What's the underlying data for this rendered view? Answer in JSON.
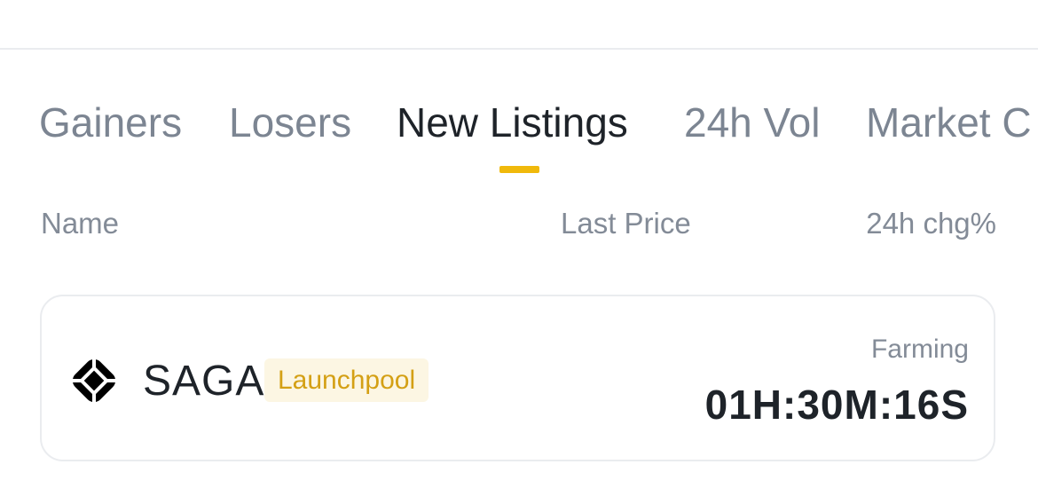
{
  "tabs": [
    {
      "label": "Gainers",
      "active": false
    },
    {
      "label": "Losers",
      "active": false
    },
    {
      "label": "New Listings",
      "active": true
    },
    {
      "label": "24h Vol",
      "active": false
    },
    {
      "label": "Market C",
      "active": false
    }
  ],
  "columns": {
    "name": "Name",
    "last_price": "Last Price",
    "change": "24h chg%"
  },
  "listing": {
    "icon": "saga-logo-icon",
    "symbol": "SAGA",
    "badge": "Launchpool",
    "status_label": "Farming",
    "countdown": "01H:30M:16S"
  },
  "colors": {
    "accent": "#f0b90b",
    "badge_text": "#d4a015",
    "badge_bg": "#fcf6e3",
    "text_primary": "#1e2329",
    "text_secondary": "#838b97"
  }
}
